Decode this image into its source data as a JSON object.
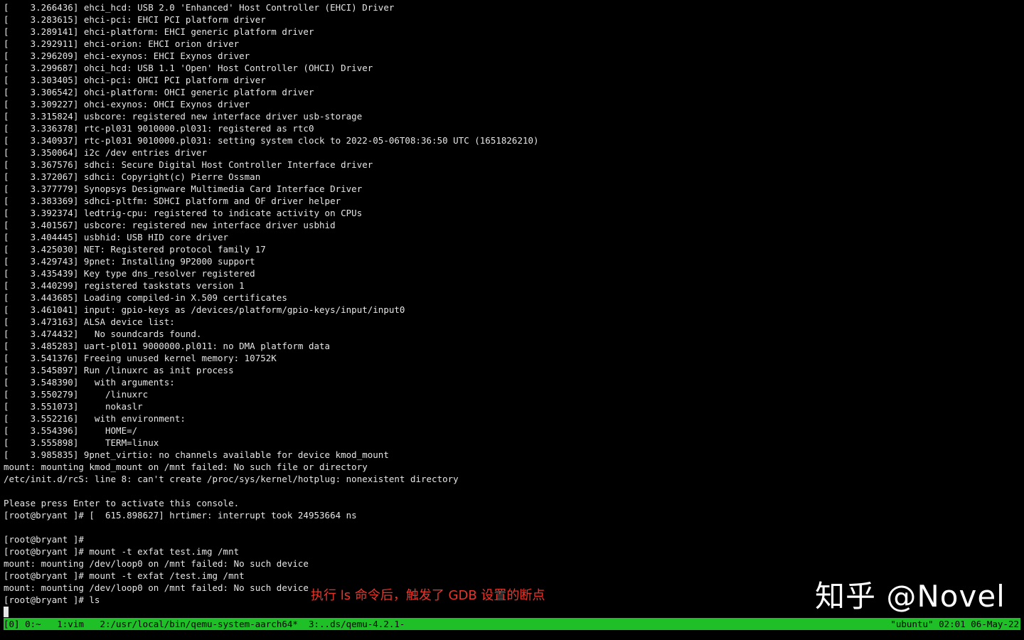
{
  "colors": {
    "background": "#000000",
    "text": "#e6e6e6",
    "statusbar": "#1fbf27",
    "annotation": "#e6352b"
  },
  "terminal": {
    "lines": [
      "[    3.266436] ehci_hcd: USB 2.0 'Enhanced' Host Controller (EHCI) Driver",
      "[    3.283615] ehci-pci: EHCI PCI platform driver",
      "[    3.289141] ehci-platform: EHCI generic platform driver",
      "[    3.292911] ehci-orion: EHCI orion driver",
      "[    3.296209] ehci-exynos: EHCI Exynos driver",
      "[    3.299687] ohci_hcd: USB 1.1 'Open' Host Controller (OHCI) Driver",
      "[    3.303405] ohci-pci: OHCI PCI platform driver",
      "[    3.306542] ohci-platform: OHCI generic platform driver",
      "[    3.309227] ohci-exynos: OHCI Exynos driver",
      "[    3.315824] usbcore: registered new interface driver usb-storage",
      "[    3.336378] rtc-pl031 9010000.pl031: registered as rtc0",
      "[    3.340937] rtc-pl031 9010000.pl031: setting system clock to 2022-05-06T08:36:50 UTC (1651826210)",
      "[    3.350064] i2c /dev entries driver",
      "[    3.367576] sdhci: Secure Digital Host Controller Interface driver",
      "[    3.372067] sdhci: Copyright(c) Pierre Ossman",
      "[    3.377779] Synopsys Designware Multimedia Card Interface Driver",
      "[    3.383369] sdhci-pltfm: SDHCI platform and OF driver helper",
      "[    3.392374] ledtrig-cpu: registered to indicate activity on CPUs",
      "[    3.401567] usbcore: registered new interface driver usbhid",
      "[    3.404445] usbhid: USB HID core driver",
      "[    3.425030] NET: Registered protocol family 17",
      "[    3.429743] 9pnet: Installing 9P2000 support",
      "[    3.435439] Key type dns_resolver registered",
      "[    3.440299] registered taskstats version 1",
      "[    3.443685] Loading compiled-in X.509 certificates",
      "[    3.461041] input: gpio-keys as /devices/platform/gpio-keys/input/input0",
      "[    3.473163] ALSA device list:",
      "[    3.474432]   No soundcards found.",
      "[    3.485283] uart-pl011 9000000.pl011: no DMA platform data",
      "[    3.541376] Freeing unused kernel memory: 10752K",
      "[    3.545897] Run /linuxrc as init process",
      "[    3.548390]   with arguments:",
      "[    3.550279]     /linuxrc",
      "[    3.551073]     nokaslr",
      "[    3.552216]   with environment:",
      "[    3.554396]     HOME=/",
      "[    3.555898]     TERM=linux",
      "[    3.985835] 9pnet_virtio: no channels available for device kmod_mount",
      "mount: mounting kmod_mount on /mnt failed: No such file or directory",
      "/etc/init.d/rcS: line 8: can't create /proc/sys/kernel/hotplug: nonexistent directory",
      "",
      "Please press Enter to activate this console.",
      "[root@bryant ]# [  615.898627] hrtimer: interrupt took 24953664 ns",
      "",
      "[root@bryant ]#",
      "[root@bryant ]# mount -t exfat test.img /mnt",
      "mount: mounting /dev/loop0 on /mnt failed: No such device",
      "[root@bryant ]# mount -t exfat /test.img /mnt",
      "mount: mounting /dev/loop0 on /mnt failed: No such device",
      "[root@bryant ]# ls"
    ]
  },
  "annotation": {
    "text": "执行 ls 命令后，触发了 GDB 设置的断点"
  },
  "watermark": {
    "text": "知乎 @Novel"
  },
  "statusbar": {
    "session": "[0]",
    "windows": [
      " 0:~  ",
      " 1:vim  ",
      " 2:/usr/local/bin/qemu-system-aarch64* ",
      " 3:..ds/qemu-4.2.1-"
    ],
    "host": "\"ubuntu\"",
    "time": " 02:01",
    "date": " 06-May-22"
  }
}
